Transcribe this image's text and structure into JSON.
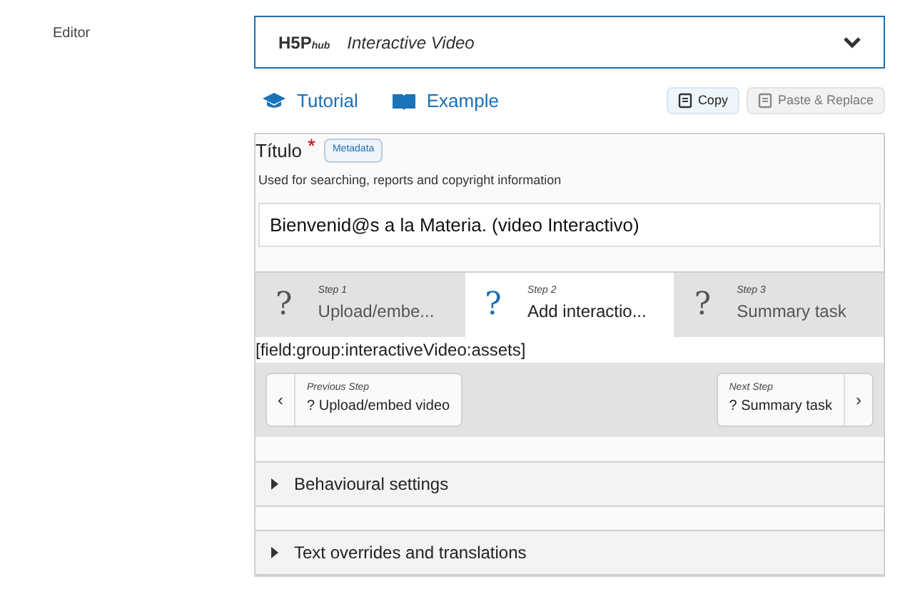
{
  "sidebar_label": "Editor",
  "hub": {
    "logo": "H5P",
    "logo_sub": "hub",
    "title": "Interactive Video",
    "expanded": false
  },
  "links": [
    {
      "kind": "tutorial",
      "label": "Tutorial"
    },
    {
      "kind": "example",
      "label": "Example"
    }
  ],
  "clipboard": [
    {
      "kind": "copy",
      "label": "Copy",
      "disabled": false
    },
    {
      "kind": "paste",
      "label": "Paste & Replace",
      "disabled": true
    }
  ],
  "title_field": {
    "label": "Título",
    "required": true,
    "required_mark": "*",
    "metadata": "Metadata",
    "description": "Used for searching, reports and copyright information",
    "value": "Bienvenid@s a la Materia. (video Interactivo)"
  },
  "steps": [
    {
      "icon": "?",
      "step": "Step 1",
      "label": "Upload/embe...",
      "selected": false
    },
    {
      "icon": "?",
      "step": "Step 2",
      "label": "Add interactio...",
      "selected": true
    },
    {
      "icon": "?",
      "step": "Step 3",
      "label": "Summary task",
      "selected": false
    }
  ],
  "field_placeholder": "[field:group:interactiveVideo:assets]",
  "nav": {
    "prev": {
      "arrow": "‹",
      "caption": "Previous Step",
      "icon": "?",
      "label": "Upload/embed video"
    },
    "next": {
      "arrow": "›",
      "caption": "Next Step",
      "icon": "?",
      "label": "Summary task"
    }
  },
  "sections": [
    {
      "label": "Behavioural settings",
      "expanded": false
    },
    {
      "label": "Text overrides and translations",
      "expanded": false
    }
  ]
}
